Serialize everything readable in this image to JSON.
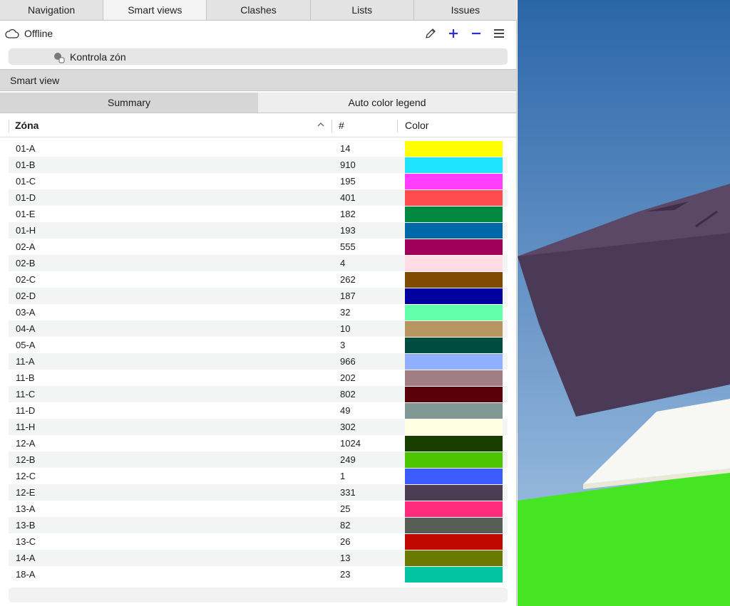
{
  "tabs": [
    {
      "label": "Navigation",
      "active": false
    },
    {
      "label": "Smart views",
      "active": true
    },
    {
      "label": "Clashes",
      "active": false
    },
    {
      "label": "Lists",
      "active": false
    },
    {
      "label": "Issues",
      "active": false
    }
  ],
  "toolbar": {
    "status": "Offline",
    "status_icon": "cloud-icon",
    "tools": [
      "pencil-icon",
      "plus-icon",
      "minus-icon",
      "menu-icon"
    ],
    "accent": "#2d2dd6"
  },
  "tree": {
    "selected_label": "Kontrola zón",
    "icon": "smart-view-icon"
  },
  "smart_view": {
    "header": "Smart view",
    "subtabs": [
      {
        "label": "Summary",
        "active": true
      },
      {
        "label": "Auto color legend",
        "active": false
      }
    ]
  },
  "table": {
    "columns": [
      "Zóna",
      "#",
      "Color"
    ],
    "sort_icon": "chevron-up-icon",
    "rows": [
      {
        "zone": "01-A",
        "count": "14",
        "color": "#ffff00"
      },
      {
        "zone": "01-B",
        "count": "910",
        "color": "#1ee4ff"
      },
      {
        "zone": "01-C",
        "count": "195",
        "color": "#ff3cff"
      },
      {
        "zone": "01-D",
        "count": "401",
        "color": "#ff4c4c"
      },
      {
        "zone": "01-E",
        "count": "182",
        "color": "#008840"
      },
      {
        "zone": "01-H",
        "count": "193",
        "color": "#0068a8"
      },
      {
        "zone": "02-A",
        "count": "555",
        "color": "#a0005a"
      },
      {
        "zone": "02-B",
        "count": "4",
        "color": "#ffdce4"
      },
      {
        "zone": "02-C",
        "count": "262",
        "color": "#7e4a00"
      },
      {
        "zone": "02-D",
        "count": "187",
        "color": "#0000a0"
      },
      {
        "zone": "03-A",
        "count": "32",
        "color": "#62ffaa"
      },
      {
        "zone": "04-A",
        "count": "10",
        "color": "#b89460"
      },
      {
        "zone": "05-A",
        "count": "3",
        "color": "#004c40"
      },
      {
        "zone": "11-A",
        "count": "966",
        "color": "#90b0ff"
      },
      {
        "zone": "11-B",
        "count": "202",
        "color": "#a07e84"
      },
      {
        "zone": "11-C",
        "count": "802",
        "color": "#5a0008"
      },
      {
        "zone": "11-D",
        "count": "49",
        "color": "#809894"
      },
      {
        "zone": "11-H",
        "count": "302",
        "color": "#ffffe4"
      },
      {
        "zone": "12-A",
        "count": "1024",
        "color": "#183e00"
      },
      {
        "zone": "12-B",
        "count": "249",
        "color": "#4cc400"
      },
      {
        "zone": "12-C",
        "count": "1",
        "color": "#3c5cff"
      },
      {
        "zone": "12-E",
        "count": "331",
        "color": "#4c3c54"
      },
      {
        "zone": "13-A",
        "count": "25",
        "color": "#ff2c7e"
      },
      {
        "zone": "13-B",
        "count": "82",
        "color": "#565e56"
      },
      {
        "zone": "13-C",
        "count": "26",
        "color": "#c00800"
      },
      {
        "zone": "14-A",
        "count": "13",
        "color": "#6a7800"
      },
      {
        "zone": "18-A",
        "count": "23",
        "color": "#00c4a2"
      }
    ]
  },
  "viewport": {
    "sky_top": "#2b66a9",
    "sky_bottom": "#a9c7e6",
    "roof": "#4b3a57",
    "ground": "#45e524"
  }
}
